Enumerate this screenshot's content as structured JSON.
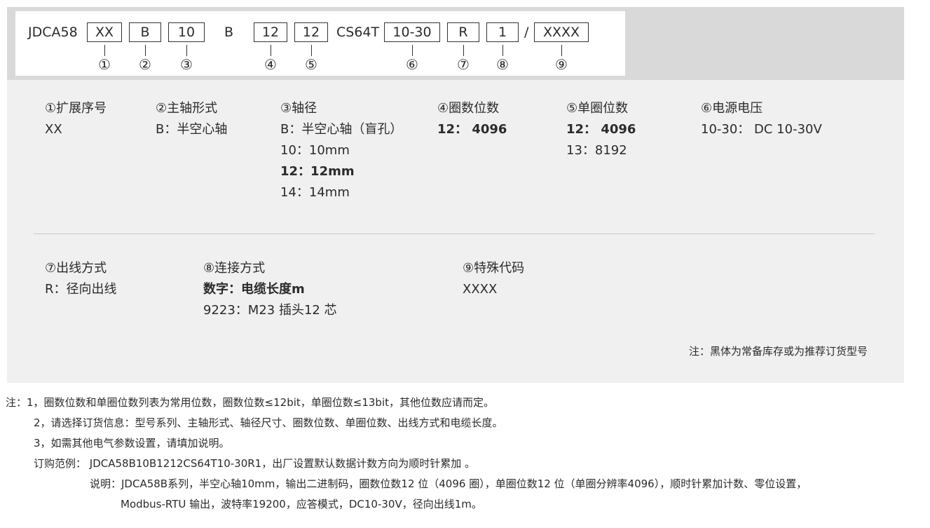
{
  "model_code": {
    "prefix": "JDCA58",
    "fields": [
      "XX",
      "B",
      "10",
      "12",
      "12",
      "10-30",
      "R",
      "1",
      "XXXX"
    ],
    "literal_b": "B",
    "literal_cs": "CS64T",
    "slash": "/",
    "markers": [
      "①",
      "②",
      "③",
      "④",
      "⑤",
      "⑥",
      "⑦",
      "⑧",
      "⑨"
    ]
  },
  "options_row1": [
    {
      "title": "①扩展序号",
      "lines": [
        {
          "text": "XX",
          "bold": false
        }
      ]
    },
    {
      "title": "②主轴形式",
      "lines": [
        {
          "text": "B：半空心轴",
          "bold": false
        }
      ]
    },
    {
      "title": "③轴径",
      "lines": [
        {
          "text": "B：半空心轴（盲孔）",
          "bold": false
        },
        {
          "text": "10：10mm",
          "bold": false
        },
        {
          "text": "12：12mm",
          "bold": true
        },
        {
          "text": "14：14mm",
          "bold": false
        }
      ]
    },
    {
      "title": "④圈数位数",
      "lines": [
        {
          "text": "12： 4096",
          "bold": true
        }
      ]
    },
    {
      "title": "⑤单圈位数",
      "lines": [
        {
          "text": "12： 4096",
          "bold": true
        },
        {
          "text": "13：8192",
          "bold": false
        }
      ]
    },
    {
      "title": "⑥电源电压",
      "lines": [
        {
          "text": "10-30： DC 10-30V",
          "bold": false
        }
      ]
    }
  ],
  "options_row2": [
    {
      "title": "⑦出线方式",
      "lines": [
        {
          "text": "R：径向出线",
          "bold": false
        }
      ]
    },
    {
      "title": "⑧连接方式",
      "lines": [
        {
          "text": "数字：电缆长度m",
          "bold": true
        },
        {
          "text": "9223：M23 插头12 芯",
          "bold": false
        }
      ]
    },
    {
      "title": "⑨特殊代码",
      "lines": [
        {
          "text": "XXXX",
          "bold": false
        }
      ]
    }
  ],
  "panel_note": "注：黑体为常备库存或为推荐订货型号",
  "notes": {
    "line1": "注：1，圈数位数和单圈位数列表为常用位数，圈数位数≤12bit，单圈位数≤13bit，其他位数应请而定。",
    "line2": "2，请选择订货信息：型号系列、主轴形式、轴径尺寸、圈数位数、单圈位数、出线方式和电缆长度。",
    "line3": "3，如需其他电气参数设置，请填加说明。",
    "line4": "订购范例： JDCA58B10B1212CS64T10-30R1，出厂设置默认数据计数方向为顺时针累加 。",
    "line5": "说明：JDCA58B系列，半空心轴10mm，输出二进制码，圈数位数12 位（4096 圈），单圈位数12 位（单圈分辨率4096），顺时针累加计数、零位设置，",
    "line6": "Modbus-RTU 输出，波特率19200，应答模式，DC10-30V，径向出线1m。"
  }
}
